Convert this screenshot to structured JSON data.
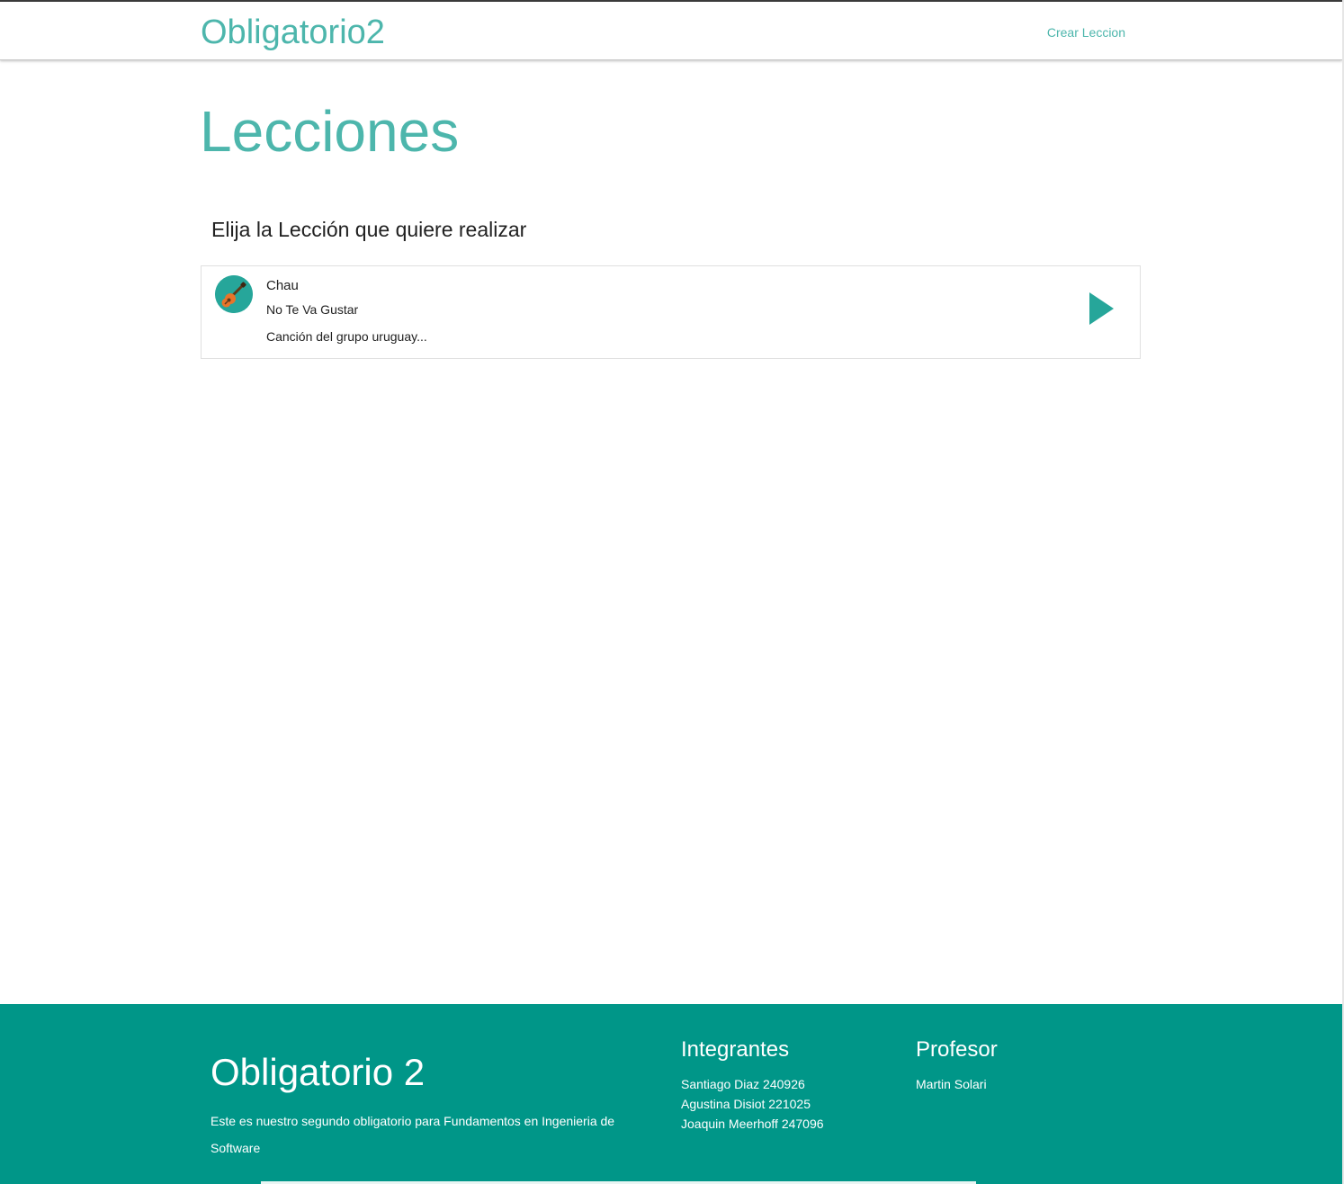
{
  "nav": {
    "brand": "Obligatorio2",
    "links": [
      {
        "label": "Crear Leccion"
      }
    ]
  },
  "main": {
    "title": "Lecciones",
    "subtitle": "Elija la Lección que quiere realizar",
    "lessons": [
      {
        "icon": "guitar-icon",
        "title": "Chau",
        "song": "No Te Va Gustar",
        "description": "Canción del grupo uruguay...",
        "action_icon": "play-arrow-icon"
      }
    ]
  },
  "footer": {
    "title": "Obligatorio 2",
    "description": "Este es nuestro segundo obligatorio para Fundamentos en Ingenieria de Software",
    "members_heading": "Integrantes",
    "members": [
      "Santiago Diaz 240926",
      "Agustina Disiot 221025",
      "Joaquin Meerhoff 247096"
    ],
    "professor_heading": "Profesor",
    "professors": [
      "Martin Solari"
    ]
  },
  "colors": {
    "accent": "#4db6ac",
    "footer_bg": "#009688",
    "avatar_bg": "#26a69a",
    "play_icon": "#26a69a"
  }
}
